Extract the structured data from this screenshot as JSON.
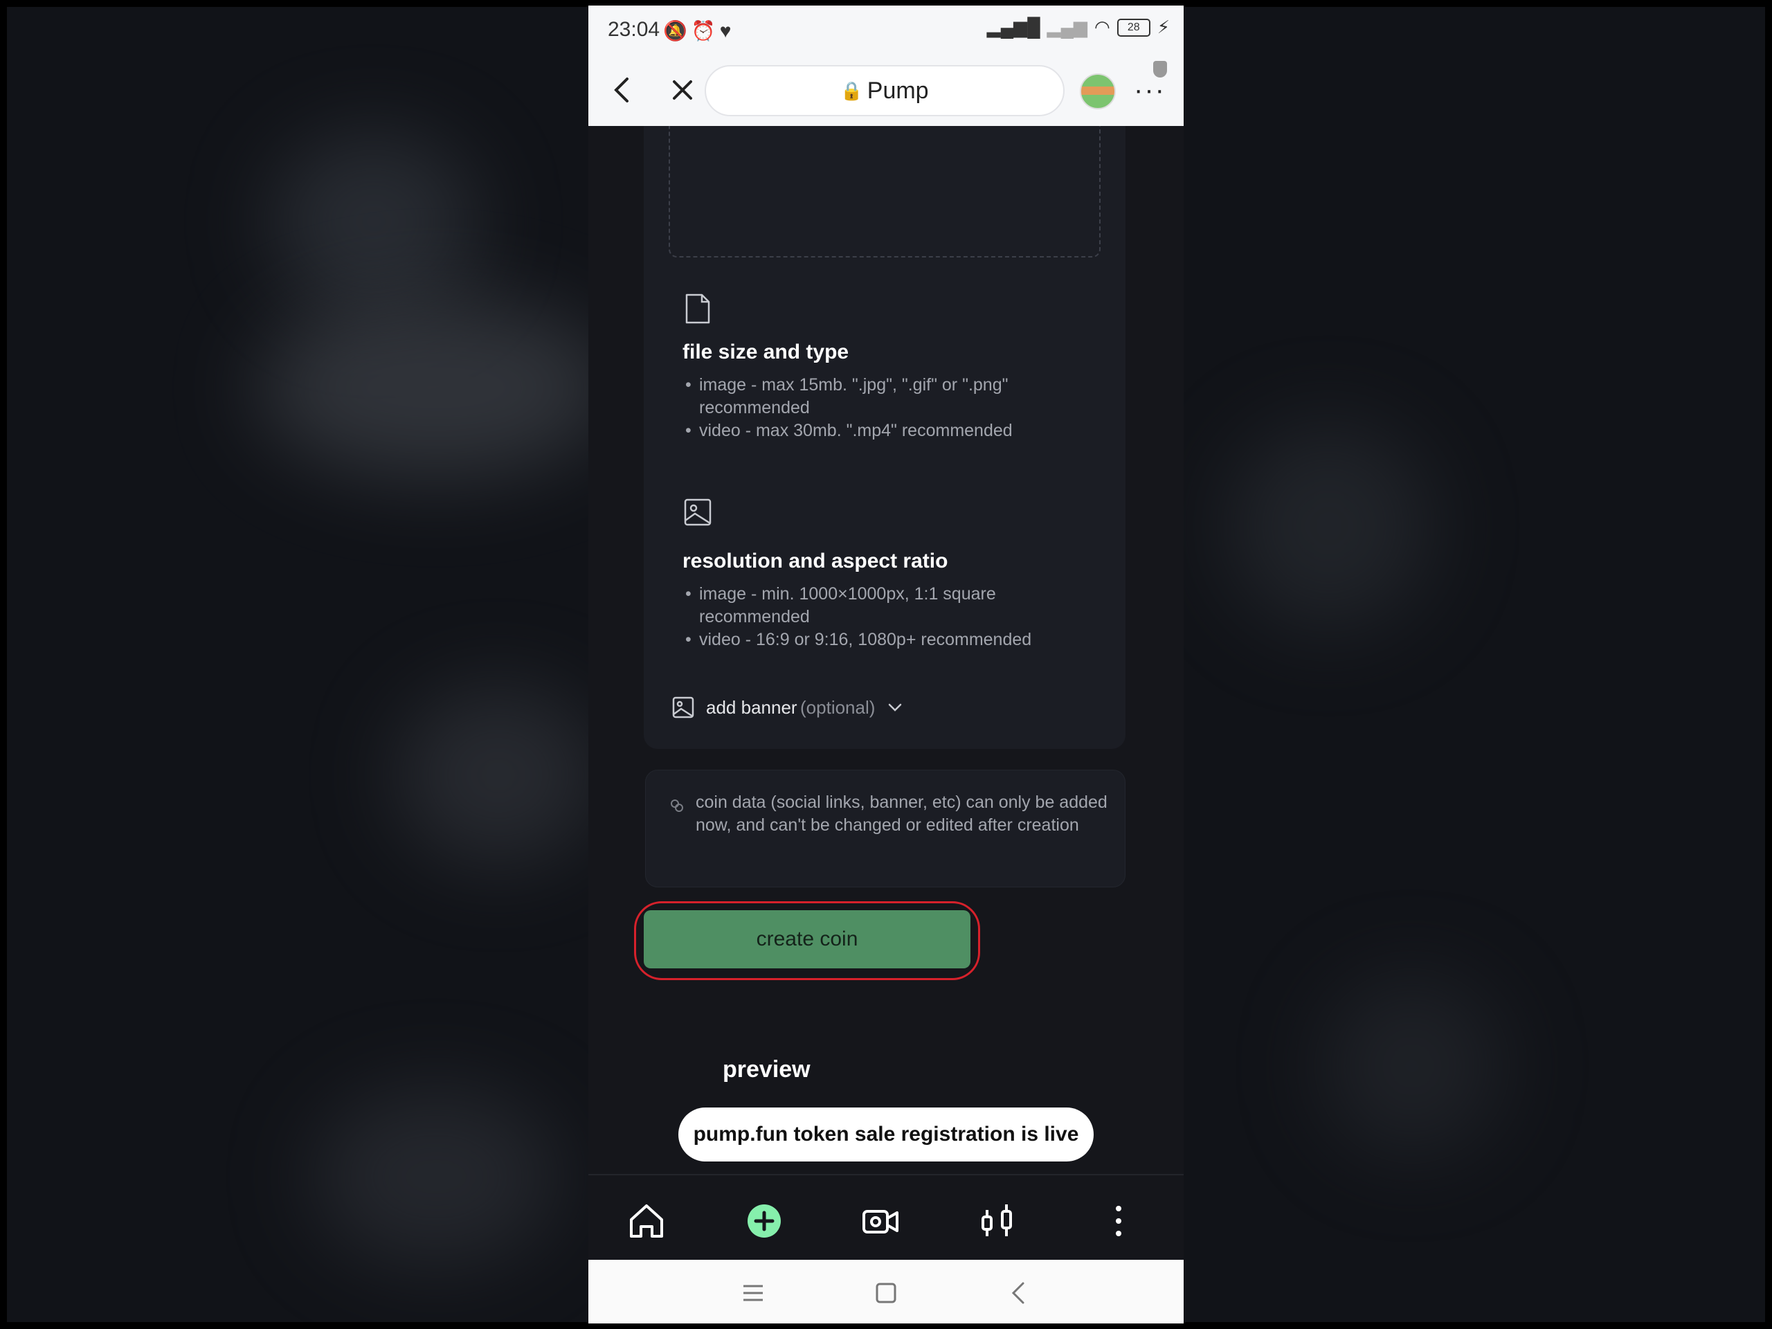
{
  "status_bar": {
    "time": "23:04",
    "battery": "28"
  },
  "browser": {
    "url_text": "Pump"
  },
  "upload": {
    "file_section": {
      "title": "file size and type",
      "items": [
        "image - max 15mb. \".jpg\", \".gif\" or \".png\" recommended",
        "video - max 30mb. \".mp4\" recommended"
      ]
    },
    "resolution_section": {
      "title": "resolution and aspect ratio",
      "items": [
        "image - min. 1000×1000px, 1:1 square recommended",
        "video - 16:9 or 9:16, 1080p+ recommended"
      ]
    },
    "banner": {
      "label": "add banner",
      "optional": "(optional)"
    }
  },
  "notice": {
    "text": "coin data (social links, banner, etc) can only be added now, and can't be changed or edited after creation"
  },
  "actions": {
    "create_label": "create coin"
  },
  "preview": {
    "title": "preview",
    "toast": "pump.fun token sale registration is live"
  },
  "colors": {
    "accent_green": "#86efac",
    "button_green": "#4f8f63",
    "highlight_red": "#d6212b",
    "background": "#15161b"
  }
}
